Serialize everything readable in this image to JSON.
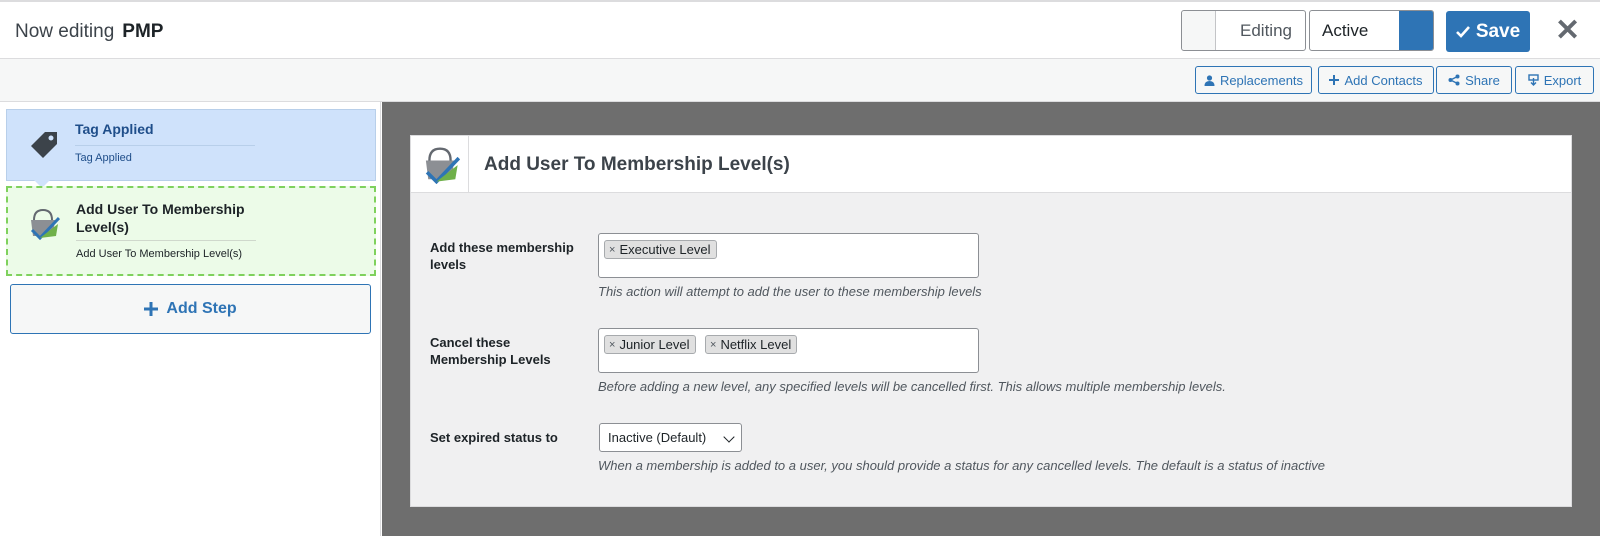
{
  "header": {
    "prefix": "Now editing",
    "funnel_name": "PMP",
    "editing_toggle_label": "Editing",
    "status_value": "Active",
    "save_label": "Save",
    "close_glyph": "✕"
  },
  "toolbar": {
    "buttons": [
      {
        "label": "Replacements",
        "icon": "person-icon"
      },
      {
        "label": "Add Contacts",
        "icon": "plus-icon"
      },
      {
        "label": "Share",
        "icon": "share-icon"
      },
      {
        "label": "Export",
        "icon": "export-icon"
      }
    ]
  },
  "sidebar": {
    "steps": [
      {
        "title": "Tag Applied",
        "subtitle": "Tag Applied",
        "icon": "tag-icon",
        "state": "selected"
      },
      {
        "title": "Add User To Membership Level(s)",
        "subtitle": "Add User To Membership Level(s)",
        "icon": "membership-icon",
        "state": "active"
      }
    ],
    "add_step_label": "Add Step"
  },
  "panel": {
    "title": "Add User To Membership Level(s)",
    "fields": {
      "add_levels": {
        "label": "Add these membership levels",
        "tags": [
          "Executive Level"
        ],
        "help": "This action will attempt to add the user to these membership levels"
      },
      "cancel_levels": {
        "label": "Cancel these Membership Levels",
        "tags": [
          "Junior Level",
          "Netflix Level"
        ],
        "help": "Before adding a new level, any specified levels will be cancelled first. This allows multiple membership levels."
      },
      "expired_status": {
        "label": "Set expired status to",
        "value": "Inactive (Default)",
        "help": "When a membership is added to a user, you should provide a status for any cancelled levels. The default is a status of inactive"
      }
    }
  },
  "colors": {
    "accent": "#2e74b5",
    "selected_step_bg": "#cfe2fb",
    "active_step_bg": "#ecfbe8",
    "active_step_border": "#7fd15d",
    "workspace_bg": "#6e6e6e"
  }
}
